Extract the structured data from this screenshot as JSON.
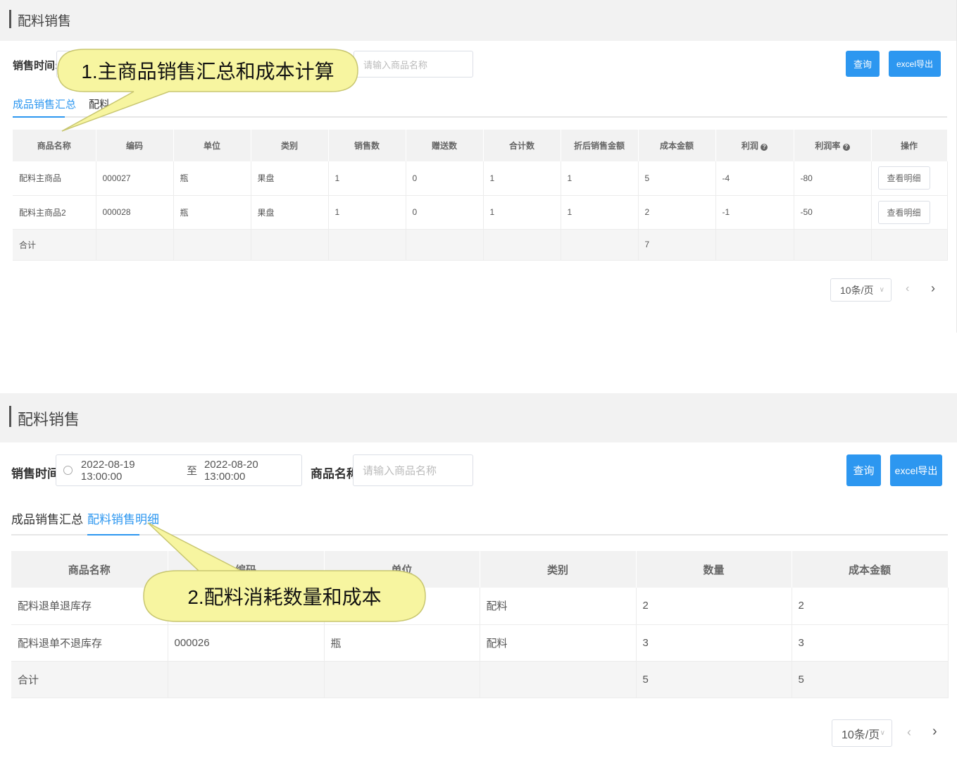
{
  "panel1": {
    "title": "配料销售",
    "sales_time_label": "销售时间:",
    "search_placeholder": "请输入商品名称",
    "query_button": "查询",
    "export_button": "excel导出",
    "tabs": [
      "成品销售汇总",
      "配料"
    ],
    "columns": [
      "商品名称",
      "编码",
      "单位",
      "类别",
      "销售数",
      "赠送数",
      "合计数",
      "折后销售金额",
      "成本金额",
      "利润",
      "利润率",
      "操作"
    ],
    "rows": [
      [
        "配料主商品",
        "000027",
        "瓶",
        "果盘",
        "1",
        "0",
        "1",
        "1",
        "5",
        "-4",
        "-80"
      ],
      [
        "配料主商品2",
        "000028",
        "瓶",
        "果盘",
        "1",
        "0",
        "1",
        "1",
        "2",
        "-1",
        "-50"
      ]
    ],
    "detail_button": "查看明细",
    "sum_label": "合计",
    "sum_cost": "7",
    "page_size": "10条/页",
    "callout": "1.主商品销售汇总和成本计算"
  },
  "panel2": {
    "title": "配料销售",
    "sales_time_label": "销售时间:",
    "date_start": "2022-08-19 13:00:00",
    "date_sep": "至",
    "date_end": "2022-08-20 13:00:00",
    "product_name_label": "商品名称",
    "search_placeholder": "请输入商品名称",
    "query_button": "查询",
    "export_button": "excel导出",
    "tabs": [
      "成品销售汇总",
      "配料销售明细"
    ],
    "columns": [
      "商品名称",
      "编码",
      "单位",
      "类别",
      "数量",
      "成本金额"
    ],
    "rows": [
      [
        "配料退单退库存",
        "",
        "",
        "配料",
        "2",
        "2"
      ],
      [
        "配料退单不退库存",
        "000026",
        "瓶",
        "配料",
        "3",
        "3"
      ]
    ],
    "sum_label": "合计",
    "sum_quantity": "5",
    "sum_cost": "5",
    "page_size": "10条/页",
    "callout": "2.配料消耗数量和成本"
  },
  "colors": {
    "accent": "#2d97f0",
    "callout_fill": "#f7f5a0"
  }
}
